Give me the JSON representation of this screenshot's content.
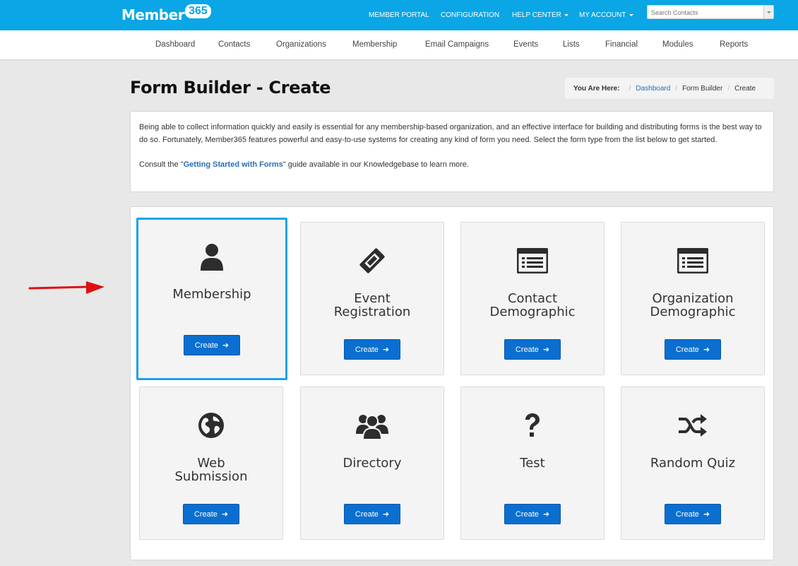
{
  "brand": {
    "name": "Member",
    "number": "365"
  },
  "topnav": {
    "member_portal": "MEMBER PORTAL",
    "configuration": "CONFIGURATION",
    "help_center": "HELP CENTER",
    "my_account": "MY ACCOUNT",
    "search_placeholder": "Search Contacts"
  },
  "subnav": [
    "Dashboard",
    "Contacts",
    "Organizations",
    "Membership",
    "Email Campaigns",
    "Events",
    "Lists",
    "Financial",
    "Modules",
    "Reports"
  ],
  "page": {
    "title": "Form Builder - Create"
  },
  "breadcrumb": {
    "label": "You Are Here:",
    "dashboard": "Dashboard",
    "form_builder": "Form Builder",
    "current": "Create"
  },
  "info": {
    "paragraph": "Being able to collect information quickly and easily is essential for any membership-based organization, and an effective interface for building and distributing forms is the best way to do so. Fortunately, Member365 features powerful and easy-to-use systems for creating any kind of form you need. Select the form type from the list below to get started.",
    "consult_prefix": "Consult the \"",
    "guide_link": "Getting Started with Forms",
    "consult_suffix": "\" guide available in our Knowledgebase to learn more."
  },
  "cards": [
    {
      "title": "Membership",
      "icon": "user-icon",
      "button": "Create",
      "selected": true
    },
    {
      "title": "Event Registration",
      "icon": "ticket-icon",
      "button": "Create"
    },
    {
      "title": "Contact Demographic",
      "icon": "list-icon",
      "button": "Create"
    },
    {
      "title": "Organization Demographic",
      "icon": "list-icon",
      "button": "Create"
    },
    {
      "title": "Web Submission",
      "icon": "globe-icon",
      "button": "Create"
    },
    {
      "title": "Directory",
      "icon": "users-icon",
      "button": "Create"
    },
    {
      "title": "Test",
      "icon": "question-icon",
      "button": "Create"
    },
    {
      "title": "Random Quiz",
      "icon": "shuffle-icon",
      "button": "Create"
    }
  ],
  "colors": {
    "topbar": "#0aa6e6",
    "button": "#0a6fd0",
    "selected_border": "#1aa3ec",
    "annotation_arrow": "#e01010"
  }
}
